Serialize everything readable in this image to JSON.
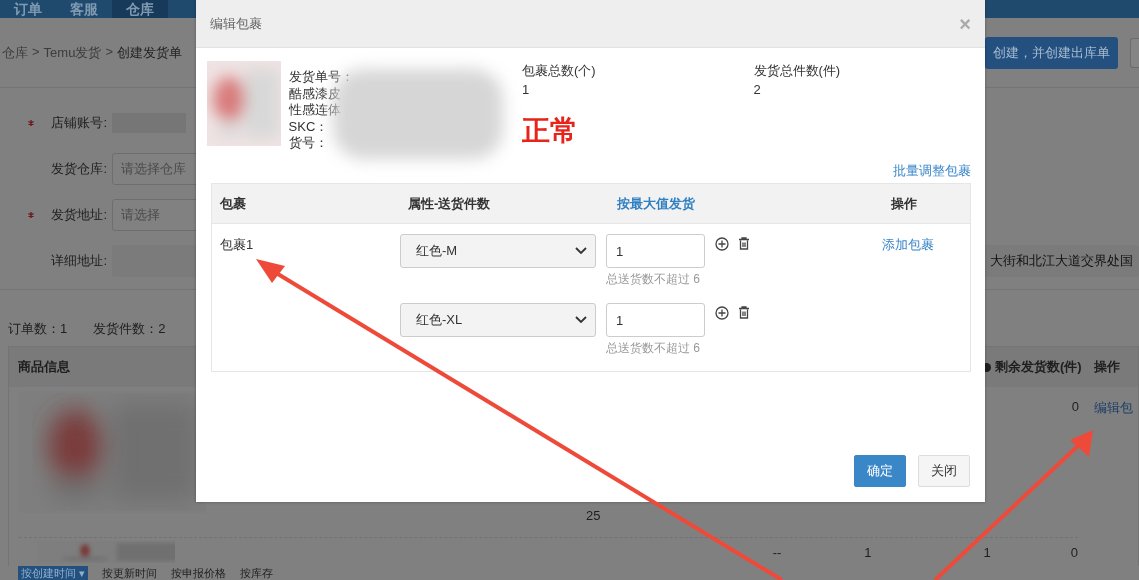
{
  "nav": {
    "tabs": [
      {
        "label": "订单",
        "selected": false
      },
      {
        "label": "客服",
        "selected": false
      },
      {
        "label": "仓库",
        "selected": true
      }
    ]
  },
  "breadcrumb": [
    {
      "text": "仓库",
      "kind": "crumb"
    },
    {
      "text": ">",
      "kind": "sep"
    },
    {
      "text": "Temu发货",
      "kind": "crumb"
    },
    {
      "text": ">",
      "kind": "sep"
    },
    {
      "text": "创建发货单",
      "kind": "current"
    }
  ],
  "header_button": "创建，并创建出库单",
  "form": [
    {
      "label": "店铺账号:",
      "required": true,
      "kind": "redacted"
    },
    {
      "label": "发货仓库:",
      "required": false,
      "kind": "select",
      "placeholder": "请选择仓库"
    },
    {
      "label": "发货地址:",
      "required": true,
      "kind": "select",
      "placeholder": "请选择"
    },
    {
      "label": "详细地址:",
      "required": false,
      "kind": "text",
      "value": "大街和北江大道交界处国"
    }
  ],
  "summary": [
    "订单数：1",
    "发货件数：2"
  ],
  "goods_table": {
    "columns": [
      "商品信息",
      "剩余发货数(件)",
      "操作"
    ],
    "row_1": {
      "remaining": "0",
      "action": "编辑包",
      "count": "25"
    },
    "row_2": {
      "cells": [
        "--",
        "1",
        "1",
        "0"
      ]
    }
  },
  "sort_bar": [
    {
      "label": "按创建时间 ▾",
      "selected": true
    },
    {
      "label": "按更新时间",
      "selected": false
    },
    {
      "label": "按申报价格",
      "selected": false
    },
    {
      "label": "按库存",
      "selected": false
    }
  ],
  "dialog": {
    "title": "编辑包裹",
    "close": "×",
    "info_lines": [
      "发货单号：",
      "酷感漆皮",
      "性感连体",
      "SKC：",
      "货号："
    ],
    "stats": [
      {
        "label": "包裹总数(个)",
        "value": "1"
      },
      {
        "label": "发货总件数(件)",
        "value": "2"
      }
    ],
    "status": "正常",
    "batch_link": "批量调整包裹",
    "table": {
      "columns": [
        {
          "label": "包裹",
          "kind": "text"
        },
        {
          "label": "属性-送货件数",
          "kind": "text"
        },
        {
          "label": "按最大值发货",
          "kind": "link"
        },
        {
          "label": "操作",
          "kind": "text"
        }
      ],
      "package": "包裹1",
      "action": "添加包裹",
      "lines": [
        {
          "attribute": "红色-M",
          "quantity": "1",
          "hint": "总送货数不超过 6"
        },
        {
          "attribute": "红色-XL",
          "quantity": "1",
          "hint": "总送货数不超过 6"
        }
      ]
    },
    "buttons": [
      {
        "label": "确定",
        "kind": "primary"
      },
      {
        "label": "关闭",
        "kind": "default"
      }
    ]
  }
}
